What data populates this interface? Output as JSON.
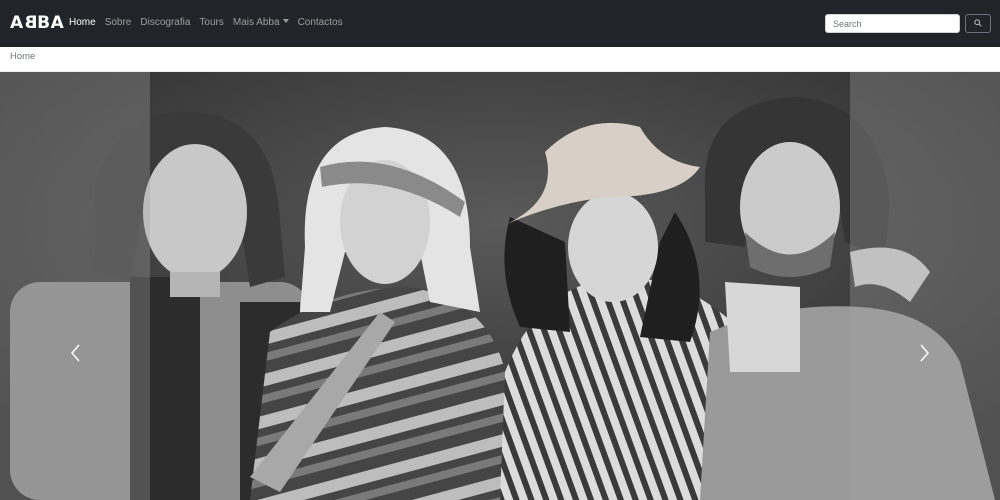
{
  "brand": {
    "text_main": "A",
    "text_rev": "B",
    "text_end": "BA"
  },
  "nav": {
    "items": [
      {
        "label": "Home",
        "active": true
      },
      {
        "label": "Sobre"
      },
      {
        "label": "Discografia"
      },
      {
        "label": "Tours"
      },
      {
        "label": "Mais Abba",
        "dropdown": true
      },
      {
        "label": "Contactos"
      }
    ]
  },
  "search": {
    "placeholder": "Search",
    "button_icon": "search-icon"
  },
  "breadcrumb": {
    "current": "Home"
  },
  "carousel": {
    "image": "abba-band-photo",
    "prev_icon": "chevron-left-icon",
    "next_icon": "chevron-right-icon"
  },
  "colors": {
    "navbar": "#212529",
    "nav_active": "#ffffff",
    "nav_inactive": "rgba(255,255,255,0.55)",
    "accent_border": "#6c757d"
  }
}
